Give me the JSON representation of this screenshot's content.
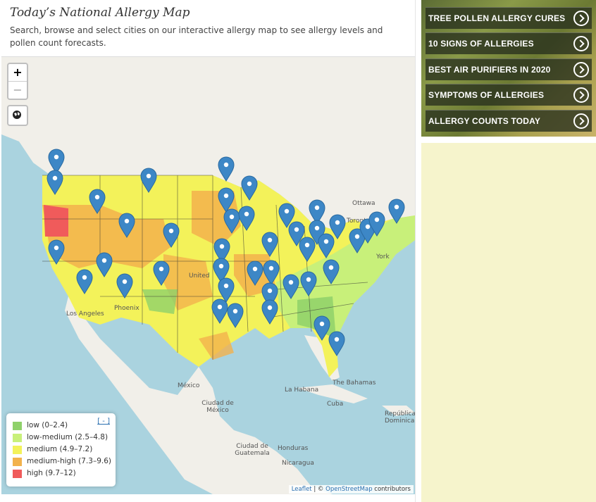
{
  "page": {
    "title": "Today’s National Allergy Map",
    "subtitle": "Search, browse and select cities on our interactive allergy map to see allergy levels and pollen count forecasts."
  },
  "map": {
    "zoom_in": "+",
    "zoom_out": "−",
    "place_labels": {
      "ottawa": "Ottawa",
      "toronto": "Toronto",
      "york": "York",
      "united": "United",
      "los_angeles": "Los Angeles",
      "phoenix": "Phoenix",
      "mexico": "México",
      "ciudad_mexico": "Ciudad de México",
      "la_habana": "La Habana",
      "cuba": "Cuba",
      "the_bahamas": "The Bahamas",
      "republica_dominicana": "República Dominicana",
      "ciudad_guatemala": "Ciudad de Guatemala",
      "honduras": "Honduras",
      "nicaragua": "Nicaragua"
    },
    "legend": {
      "collapse_label": "[ - ]",
      "items": [
        {
          "label": "low (0–2.4)",
          "color": "#8fd16a"
        },
        {
          "label": "low-medium (2.5–4.8)",
          "color": "#c8f07a"
        },
        {
          "label": "medium (4.9–7.2)",
          "color": "#f3f25a"
        },
        {
          "label": "medium-high (7.3–9.6)",
          "color": "#f2b24c"
        },
        {
          "label": "high (9.7–12)",
          "color": "#f05b5b"
        }
      ]
    },
    "attribution": {
      "leaflet": "Leaflet",
      "separator": " | © ",
      "osm": "OpenStreetMap",
      "suffix": " contributors"
    },
    "marker_color": "#3d87c6"
  },
  "sidebar": {
    "links": [
      {
        "label": "TREE POLLEN ALLERGY CURES"
      },
      {
        "label": "10 SIGNS OF ALLERGIES"
      },
      {
        "label": "BEST AIR PURIFIERS IN 2020"
      },
      {
        "label": "SYMPTOMS OF ALLERGIES"
      },
      {
        "label": "ALLERGY COUNTS TODAY"
      }
    ]
  }
}
